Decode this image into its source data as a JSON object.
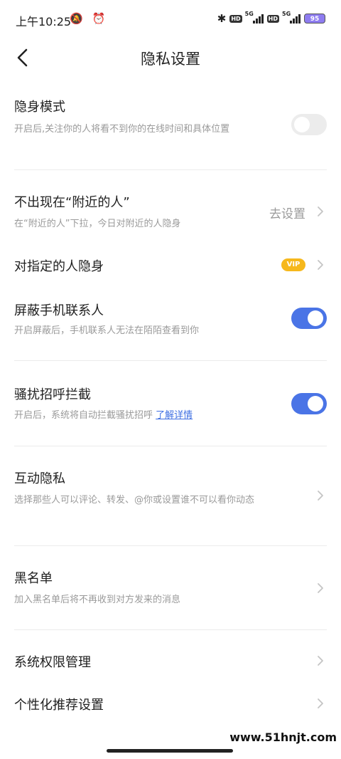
{
  "status_bar": {
    "time": "上午10:25",
    "icons_left": "🔕 ⏰",
    "bluetooth": "✱",
    "hd1": "HD",
    "net1": "5G",
    "hd2": "HD",
    "net2": "5G",
    "battery": "95"
  },
  "nav": {
    "title": "隐私设置"
  },
  "items": {
    "stealth": {
      "title": "隐身模式",
      "desc": "开启后,关注你的人将看不到你的在线时间和具体位置",
      "enabled": false
    },
    "nearby": {
      "title": "不出现在“附近的人”",
      "desc": "在“附近的人”下拉，今日对附近的人隐身",
      "action": "去设置"
    },
    "specific_hide": {
      "title": "对指定的人隐身",
      "badge": "VIP"
    },
    "block_contacts": {
      "title": "屏蔽手机联系人",
      "desc": "开启屏蔽后，手机联系人无法在陌陌查看到你",
      "enabled": true
    },
    "harassment": {
      "title": "骚扰招呼拦截",
      "desc": "开启后，系统将自动拦截骚扰招呼",
      "link": "了解详情",
      "enabled": true
    },
    "interaction": {
      "title": "互动隐私",
      "desc": "选择那些人可以评论、转发、@你或设置谁不可以看你动态"
    },
    "blacklist": {
      "title": "黑名单",
      "desc": "加入黑名单后将不再收到对方发来的消息"
    },
    "permissions": {
      "title": "系统权限管理"
    },
    "personalized": {
      "title": "个性化推荐设置"
    }
  },
  "watermark": "www.51hnjt.com",
  "colors": {
    "accent": "#4a74e6",
    "toggle_off": "#ececec",
    "vip": "#f6b81c",
    "link": "#3f6fe2"
  }
}
